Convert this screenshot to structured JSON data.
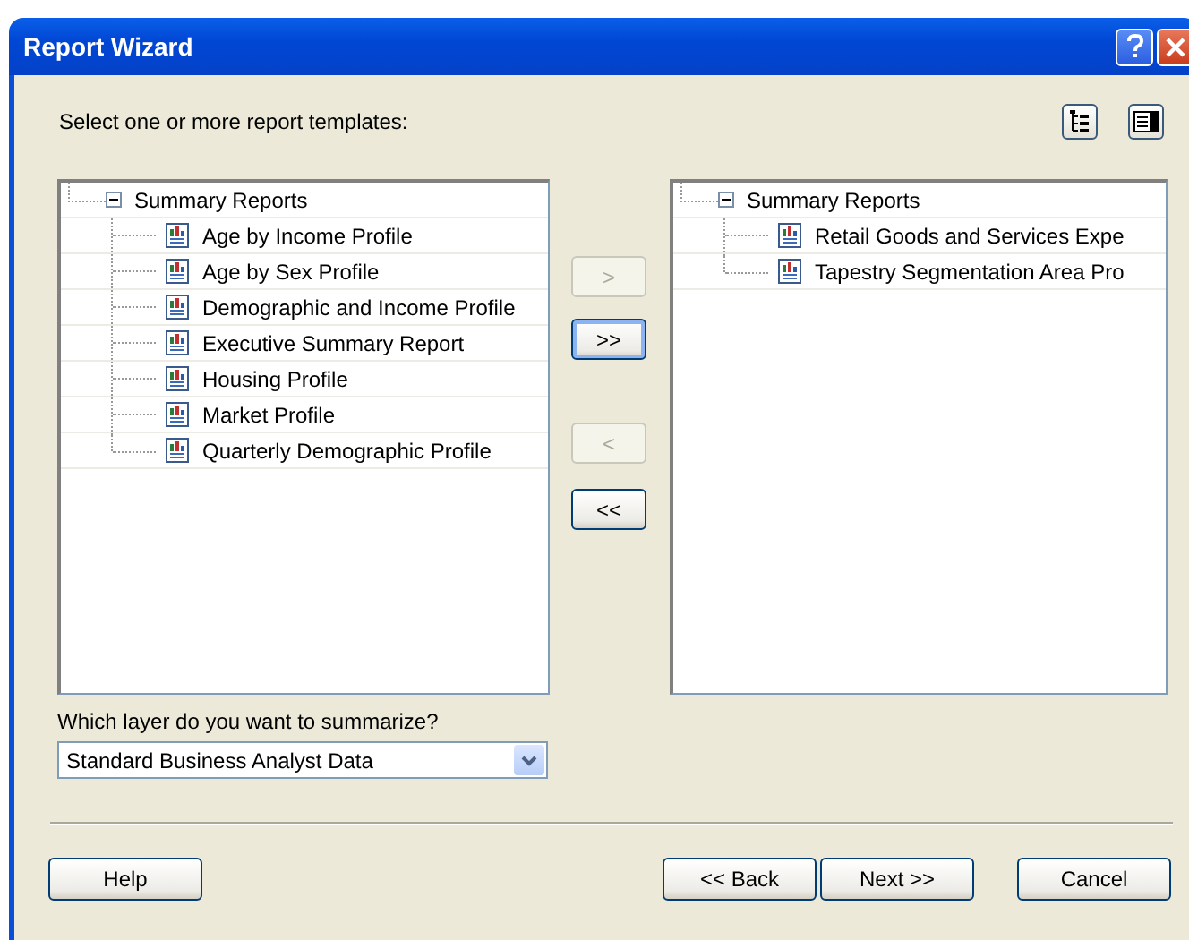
{
  "window": {
    "title": "Report Wizard"
  },
  "prompt": "Select one or more report templates:",
  "available_tree": {
    "label": "Summary Reports",
    "expanded": true,
    "children": [
      {
        "label": "Age by Income Profile"
      },
      {
        "label": "Age by Sex Profile"
      },
      {
        "label": "Demographic and Income Profile"
      },
      {
        "label": "Executive Summary Report"
      },
      {
        "label": "Housing Profile"
      },
      {
        "label": "Market Profile"
      },
      {
        "label": "Quarterly Demographic Profile"
      }
    ]
  },
  "move_buttons": [
    {
      "label": ">",
      "disabled": true,
      "focused": false
    },
    {
      "label": ">>",
      "disabled": false,
      "focused": true
    },
    {
      "label": "<",
      "disabled": true,
      "focused": false
    },
    {
      "label": "<<",
      "disabled": false,
      "focused": false
    }
  ],
  "selected_tree": {
    "label": "Summary Reports",
    "expanded": true,
    "children": [
      {
        "label": "Retail Goods and Services Expe"
      },
      {
        "label": "Tapestry Segmentation Area Pro"
      }
    ]
  },
  "layer": {
    "label": "Which layer do you want to summarize?",
    "value": "Standard Business Analyst Data"
  },
  "footer_buttons": [
    "Help",
    "<< Back",
    "Next >>",
    "Cancel"
  ]
}
